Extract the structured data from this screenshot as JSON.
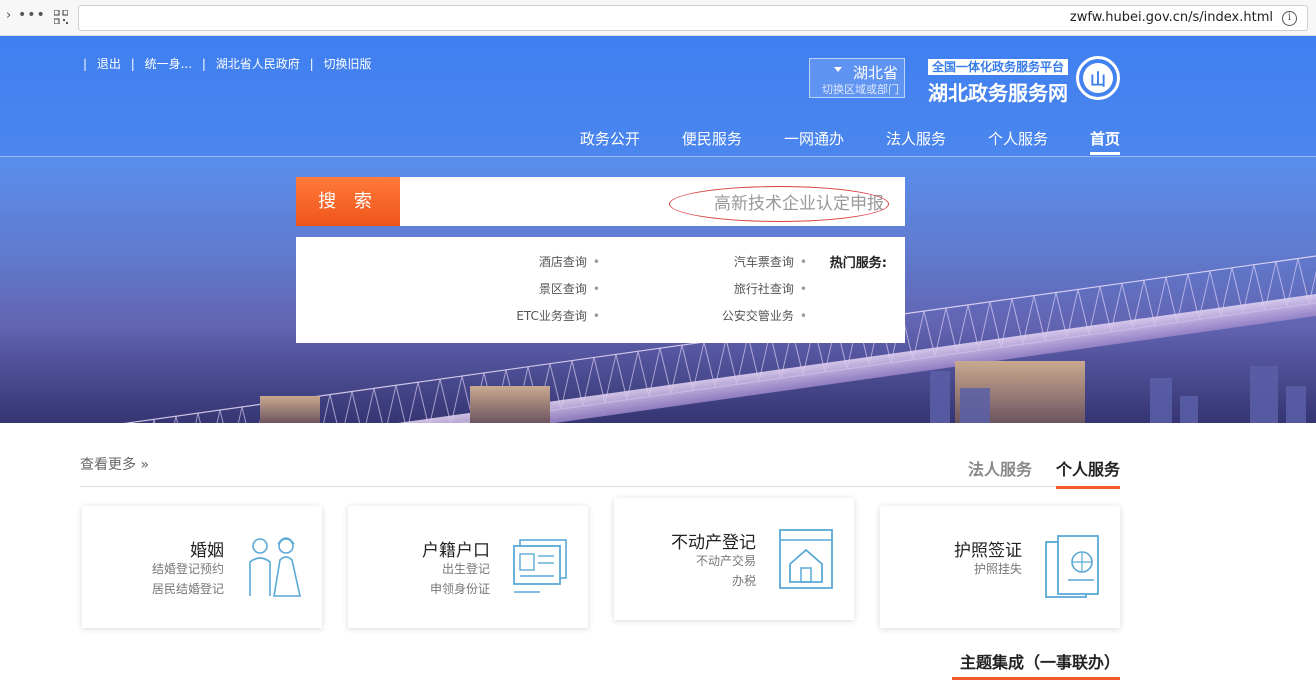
{
  "browser": {
    "url": "zwfw.hubei.gov.cn/s/index.html",
    "menu_glyph": "•••",
    "info_glyph": "i"
  },
  "header": {
    "top_links": [
      "退出",
      "统一身...",
      "湖北省人民政府",
      "切换旧版"
    ],
    "logo_badge": "全国一体化政务服务平台",
    "logo_name": "湖北政务服务网",
    "logo_glyph": "山",
    "region_name": "湖北省",
    "region_sub": "切换区域或部门"
  },
  "nav": {
    "items": [
      "首页",
      "个人服务",
      "法人服务",
      "一网通办",
      "便民服务",
      "政务公开"
    ]
  },
  "search": {
    "button_label": "搜 索",
    "value": "高新技术企业认定申报"
  },
  "hot_services": {
    "title": "热门服务:",
    "items": [
      "汽车票查询",
      "旅行社查询",
      "公安交管业务",
      "酒店查询",
      "景区查询",
      "ETC业务查询"
    ]
  },
  "section": {
    "tab_active": "个人服务",
    "tab_other": "法人服务",
    "more": "查看更多 »",
    "cards": [
      {
        "title": "护照签证",
        "sub1": "护照挂失",
        "sub2": "",
        "icon": "passport-icon"
      },
      {
        "title": "不动产登记",
        "sub1": "不动产交易",
        "sub2": "办税",
        "icon": "house-icon"
      },
      {
        "title": "户籍户口",
        "sub1": "出生登记",
        "sub2": "申领身份证",
        "icon": "id-card-icon"
      },
      {
        "title": "婚姻",
        "sub1": "结婚登记预约",
        "sub2": "居民结婚登记",
        "icon": "couple-icon"
      }
    ]
  },
  "theme": {
    "title": "主题集成（一事联办）"
  },
  "colors": {
    "accent": "#f05a28",
    "brand_blue": "#3b7de8"
  }
}
